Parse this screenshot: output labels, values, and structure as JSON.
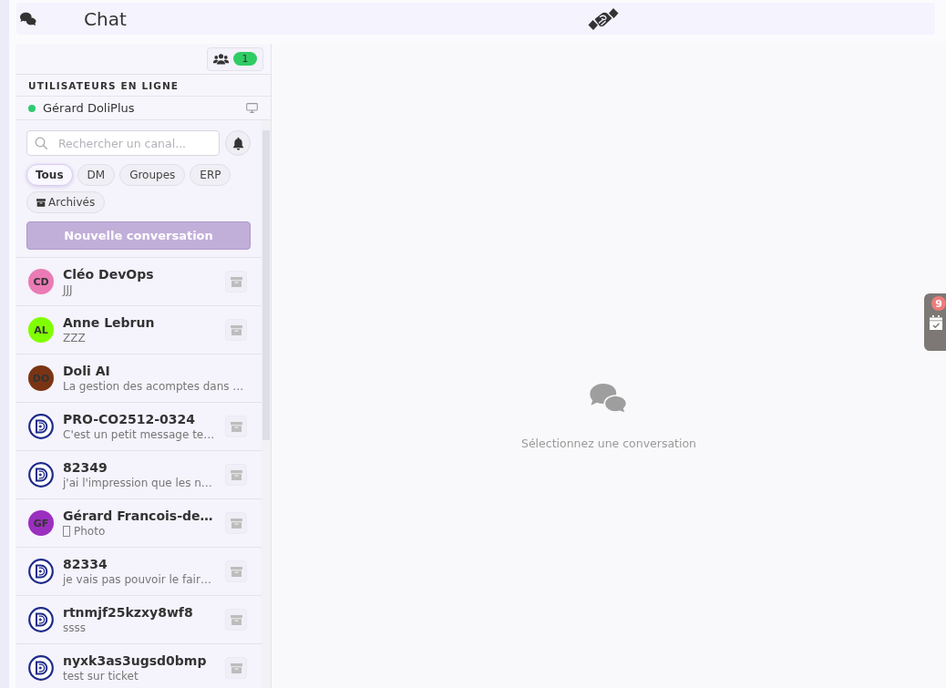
{
  "header": {
    "title": "Chat"
  },
  "sidebar": {
    "online_count": "1",
    "online_title": "UTILISATEURS EN LIGNE",
    "online_users": [
      {
        "name": "Gérard DoliPlus",
        "online": true
      }
    ],
    "search": {
      "placeholder": "Rechercher un canal..."
    },
    "filters": [
      {
        "kind": "plain",
        "label": "Tous",
        "selected": true
      },
      {
        "kind": "plain",
        "label": "DM",
        "selected": false
      },
      {
        "kind": "plain",
        "label": "Groupes",
        "selected": false
      },
      {
        "kind": "plain",
        "label": "ERP",
        "selected": false
      },
      {
        "kind": "archive",
        "label": "Archivés",
        "selected": false
      }
    ],
    "new_button": "Nouvelle conversation",
    "conversations": [
      {
        "kind": "initials",
        "initials": "CD",
        "color": "#ea7bb5",
        "name": "Cléo DevOps",
        "preview": "JJJ",
        "attachment": false,
        "archive_button": true
      },
      {
        "kind": "initials",
        "initials": "AL",
        "color": "#80ff00",
        "name": "Anne Lebrun",
        "preview": "ZZZ",
        "attachment": false,
        "archive_button": true
      },
      {
        "kind": "initials",
        "initials": "DO",
        "color": "#7a3414",
        "name": "Doli AI",
        "preview": "La gestion des acomptes dans …",
        "attachment": false,
        "archive_button": false
      },
      {
        "kind": "logo",
        "name": "PRO-CO2512-0324",
        "preview": "C'est un petit message te…",
        "attachment": false,
        "archive_button": true
      },
      {
        "kind": "logo",
        "name": "82349",
        "preview": "j'ai l'impression que les n…",
        "attachment": false,
        "archive_button": true
      },
      {
        "kind": "initials",
        "initials": "GF",
        "color": "#9b2fbf",
        "name": "Gérard Francois-de…",
        "preview": "Photo",
        "attachment": true,
        "archive_button": true
      },
      {
        "kind": "logo",
        "name": "82334",
        "preview": "je vais pas pouvoir le fair…",
        "attachment": false,
        "archive_button": true
      },
      {
        "kind": "logo",
        "name": "rtnmjf25kzxy8wf8",
        "preview": "ssss",
        "attachment": false,
        "archive_button": true
      },
      {
        "kind": "logo",
        "name": "nyxk3as3ugsd0bmp",
        "preview": "test sur ticket",
        "attachment": false,
        "archive_button": true
      }
    ]
  },
  "main": {
    "empty_text": "Sélectionnez une conversation"
  },
  "side_tab": {
    "badge": "9"
  }
}
